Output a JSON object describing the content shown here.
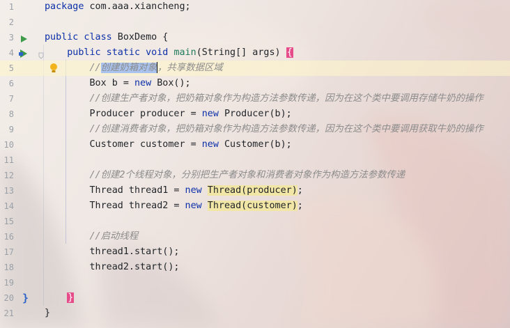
{
  "editor": {
    "lines": [
      {
        "n": "1",
        "text": "package com.aaa.xiancheng;"
      },
      {
        "n": "2",
        "text": ""
      },
      {
        "n": "3",
        "text": "public class BoxDemo {"
      },
      {
        "n": "4",
        "text": "    public static void main(String[] args) {"
      },
      {
        "n": "5",
        "text": "        //创建奶箱对象，共享数据区域"
      },
      {
        "n": "6",
        "text": "        Box b = new Box();"
      },
      {
        "n": "7",
        "text": "        //创建生产者对象，把奶箱对象作为构造方法参数传递，因为在这个类中要调用存储牛奶的操作"
      },
      {
        "n": "8",
        "text": "        Producer producer = new Producer(b);"
      },
      {
        "n": "9",
        "text": "        //创建消费者对象，把奶箱对象作为构造方法参数传递，因为在这个类中要调用获取牛奶的操作"
      },
      {
        "n": "10",
        "text": "        Customer customer = new Customer(b);"
      },
      {
        "n": "11",
        "text": ""
      },
      {
        "n": "12",
        "text": "        //创建2个线程对象，分别把生产者对象和消费者对象作为构造方法参数传递"
      },
      {
        "n": "13",
        "text": "        Thread thread1 = new Thread(producer);"
      },
      {
        "n": "14",
        "text": "        Thread thread2 = new Thread(customer);"
      },
      {
        "n": "15",
        "text": ""
      },
      {
        "n": "16",
        "text": "        //启动线程"
      },
      {
        "n": "17",
        "text": "        thread1.start();"
      },
      {
        "n": "18",
        "text": "        thread2.start();"
      },
      {
        "n": "19",
        "text": ""
      },
      {
        "n": "20",
        "text": "    }"
      },
      {
        "n": "21",
        "text": "}"
      }
    ]
  },
  "icons": {
    "run_class": "run-triangle-icon",
    "run_main": "run-triangle-icon",
    "fold": "fold-icon",
    "intention": "lightbulb-icon",
    "override": "breakpoint-marker-icon"
  },
  "colors": {
    "keyword": "#0b2fa8",
    "comment": "#8c8c8c",
    "selection": "#a9c3ee",
    "brace_highlight": "#e64c8a",
    "current_line": "#fff5c8"
  }
}
